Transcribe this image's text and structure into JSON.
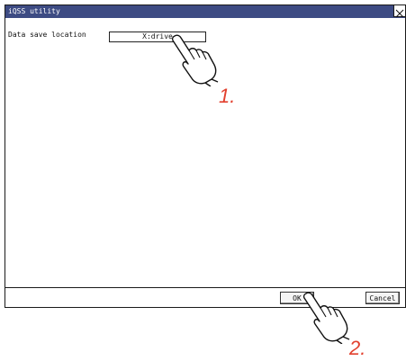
{
  "window": {
    "title": "iQSS utility"
  },
  "settings": {
    "label": "Data save location",
    "value": "X:drive"
  },
  "buttons": {
    "ok": "OK",
    "cancel": "Cancel"
  },
  "annotations": {
    "step1": "1.",
    "step2": "2."
  },
  "colors": {
    "titlebar": "#3d4b83",
    "annotation": "#e2402e"
  }
}
